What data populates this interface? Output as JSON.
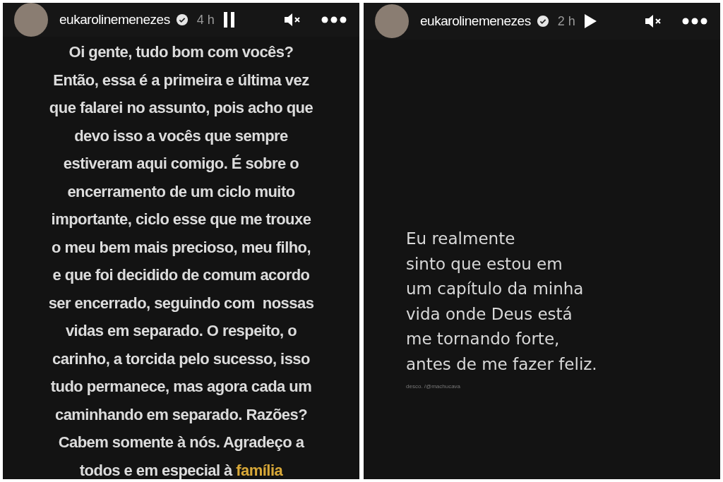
{
  "stories": [
    {
      "kind": "text-list",
      "username": "eukarolinemenezes",
      "verified": true,
      "time": "4 h",
      "playing": true,
      "muted": true,
      "lines": [
        {
          "text": "Oi gente, tudo bom com vocês?"
        },
        {
          "text": "Então, essa é a primeira e última vez"
        },
        {
          "text": "que falarei no assunto, pois acho que"
        },
        {
          "text": "devo isso a vocês que sempre"
        },
        {
          "text": "estiveram aqui comigo. É sobre o"
        },
        {
          "text": "encerramento de um ciclo muito"
        },
        {
          "text": "importante, ciclo esse que me trouxe"
        },
        {
          "text": "o meu bem mais precioso, meu filho,"
        },
        {
          "text": "e que foi decidido de comum acordo"
        },
        {
          "text": "ser encerrado, seguindo com  nossas"
        },
        {
          "text": "vidas em separado. O respeito, o"
        },
        {
          "text": "carinho, a torcida pelo sucesso, isso"
        },
        {
          "text": "tudo permanece, mas agora cada um"
        },
        {
          "text": "caminhando em separado. Razões?"
        },
        {
          "text": "Cabem somente à nós. Agradeço a"
        },
        {
          "text": "todos e em especial à ",
          "highlight": "família"
        }
      ]
    },
    {
      "kind": "quote",
      "username": "eukarolinemenezes",
      "verified": true,
      "time": "2 h",
      "playing": false,
      "muted": true,
      "lines": [
        {
          "text": "Eu realmente"
        },
        {
          "text": "sinto que estou em"
        },
        {
          "text": "um capítulo da minha"
        },
        {
          "text": "vida onde Deus está"
        },
        {
          "text": "me tornando forte,"
        },
        {
          "text": "antes de me fazer feliz."
        }
      ],
      "credit": "desco. /@machucava"
    }
  ]
}
